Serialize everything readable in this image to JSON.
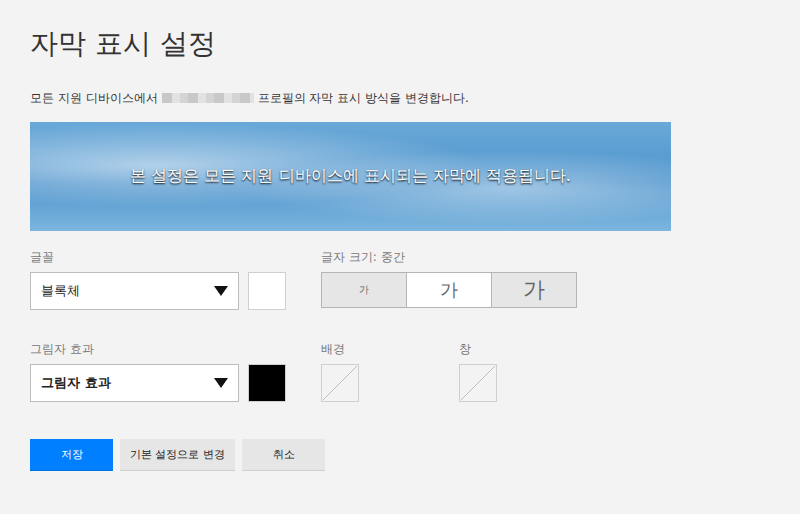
{
  "page": {
    "title": "자막 표시 설정",
    "description_before": "모든 지원 디바이스에서",
    "description_after": "프로필의 자막 표시 방식을 변경합니다."
  },
  "preview": {
    "text": "본 설정은 모든 지원 디바이스에 표시되는 자막에 적용됩니다."
  },
  "font": {
    "label": "글꼴",
    "value": "블록체",
    "color": "#ffffff"
  },
  "size": {
    "label": "글자 크기: 중간",
    "options": [
      {
        "label": "가",
        "kind": "small",
        "selected": false
      },
      {
        "label": "가",
        "kind": "medium",
        "selected": true
      },
      {
        "label": "가",
        "kind": "large",
        "selected": false
      }
    ]
  },
  "shadow": {
    "label": "그림자 효과",
    "value": "그림자 효과",
    "color": "#000000"
  },
  "background": {
    "label": "배경",
    "set": false
  },
  "window": {
    "label": "창",
    "set": false
  },
  "buttons": [
    {
      "label": "저장",
      "kind": "primary"
    },
    {
      "label": "기본 설정으로 변경",
      "kind": "secondary"
    },
    {
      "label": "취소",
      "kind": "secondary"
    }
  ]
}
